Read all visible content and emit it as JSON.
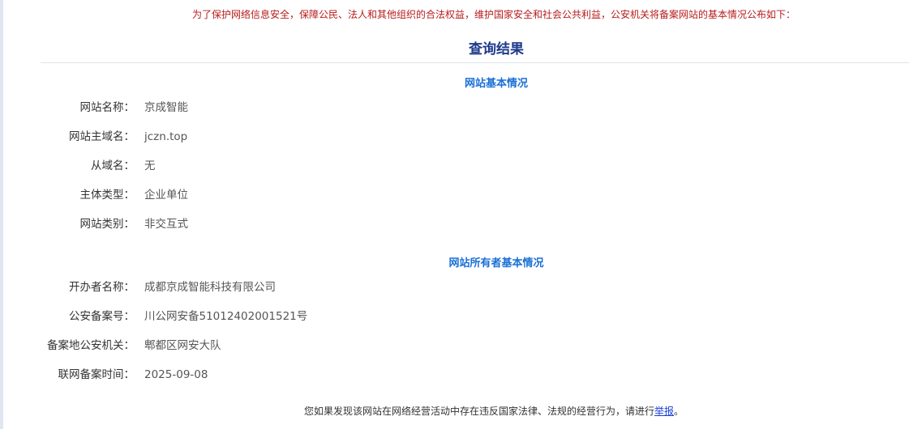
{
  "notice": "为了保护网络信息安全，保障公民、法人和其他组织的合法权益，维护国家安全和社会公共利益，公安机关将备案网站的基本情况公布如下：",
  "result_title": "查询结果",
  "site_info": {
    "title": "网站基本情况",
    "rows": [
      {
        "label": "网站名称：",
        "value": "京成智能"
      },
      {
        "label": "网站主域名：",
        "value": "jczn.top"
      },
      {
        "label": "从域名：",
        "value": "无"
      },
      {
        "label": "主体类型：",
        "value": "企业单位"
      },
      {
        "label": "网站类别：",
        "value": "非交互式"
      }
    ]
  },
  "owner_info": {
    "title": "网站所有者基本情况",
    "rows": [
      {
        "label": "开办者名称：",
        "value": "成都京成智能科技有限公司"
      },
      {
        "label": "公安备案号：",
        "value": "川公网安备51012402001521号"
      },
      {
        "label": "备案地公安机关：",
        "value": "郫都区网安大队"
      },
      {
        "label": "联网备案时间：",
        "value": "2025-09-08"
      }
    ]
  },
  "footer": {
    "text_before": "您如果发现该网站在网络经营活动中存在违反国家法律、法规的经营行为，请进行",
    "report_link": "举报",
    "text_after": "。"
  },
  "colors": {
    "notice": "#b71c1c",
    "result_title": "#1e3a8a",
    "section_title": "#1a6fd6",
    "link": "#1a3fd6"
  }
}
